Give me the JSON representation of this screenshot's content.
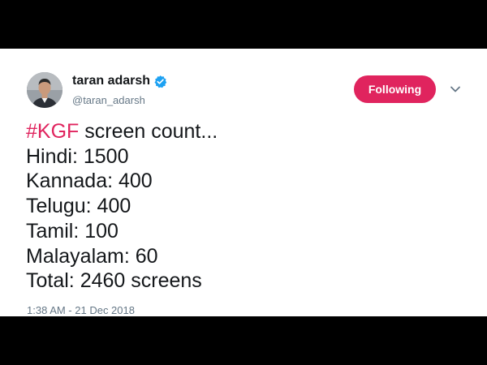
{
  "user": {
    "display_name": "taran adarsh",
    "handle": "@taran_adarsh",
    "verified": true
  },
  "follow_button": {
    "label": "Following"
  },
  "tweet": {
    "hashtag": "#KGF",
    "headline_rest": " screen count...",
    "lines": [
      "Hindi: 1500",
      "Kannada: 400",
      "Telugu: 400",
      "Tamil: 100",
      "Malayalam: 60",
      "Total: 2460 screens"
    ],
    "timestamp": "1:38 AM - 21 Dec 2018"
  },
  "icons": {
    "verified": "verified-badge-icon",
    "more": "chevron-down-icon"
  },
  "colors": {
    "accent": "#e0245e",
    "verified": "#1da1f2",
    "text": "#14171a",
    "muted": "#657786"
  }
}
